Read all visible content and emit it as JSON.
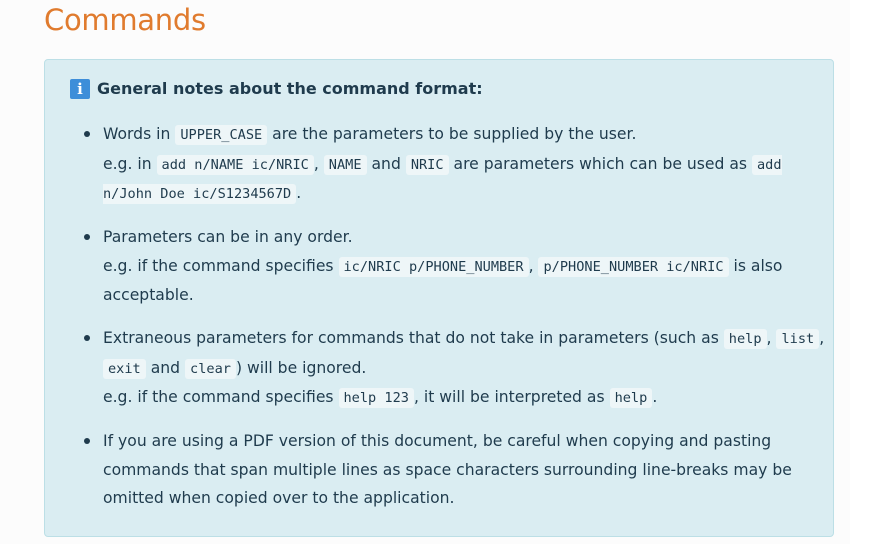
{
  "heading": "Commands",
  "note": {
    "title": "General notes about the command format:",
    "icon": "info-icon",
    "icon_glyph": "i",
    "items": [
      {
        "text1": "Words in ",
        "code1": "UPPER_CASE",
        "text2": " are the parameters to be supplied by the user.",
        "text3": "e.g. in ",
        "code2": "add n/NAME ic/NRIC",
        "text4": ", ",
        "code3": "NAME",
        "text5": " and ",
        "code4": "NRIC",
        "text6": " are parameters which can be used as ",
        "code5": "add n/John Doe ic/S1234567D",
        "text7": "."
      },
      {
        "text1": "Parameters can be in any order.",
        "text2": "e.g. if the command specifies ",
        "code1": "ic/NRIC p/PHONE_NUMBER",
        "text3": ", ",
        "code2": "p/PHONE_NUMBER ic/NRIC",
        "text4": " is also acceptable."
      },
      {
        "text1": "Extraneous parameters for commands that do not take in parameters (such as ",
        "code1": "help",
        "text2": ", ",
        "code2": "list",
        "text3": ", ",
        "code3": "exit",
        "text4": " and ",
        "code4": "clear",
        "text5": ") will be ignored.",
        "text6": "e.g. if the command specifies ",
        "code5": "help 123",
        "text7": ", it will be interpreted as ",
        "code6": "help",
        "text8": "."
      },
      {
        "text1": "If you are using a PDF version of this document, be careful when copying and pasting commands that span multiple lines as space characters surrounding line-breaks may be omitted when copied over to the application."
      }
    ]
  },
  "colors": {
    "heading": "#e07b2e",
    "alert_background": "#daedf2",
    "alert_border": "#bcdfe6",
    "icon_background": "#3d8ed9",
    "text": "#1f3b4d",
    "code_background": "#eef6f8"
  }
}
